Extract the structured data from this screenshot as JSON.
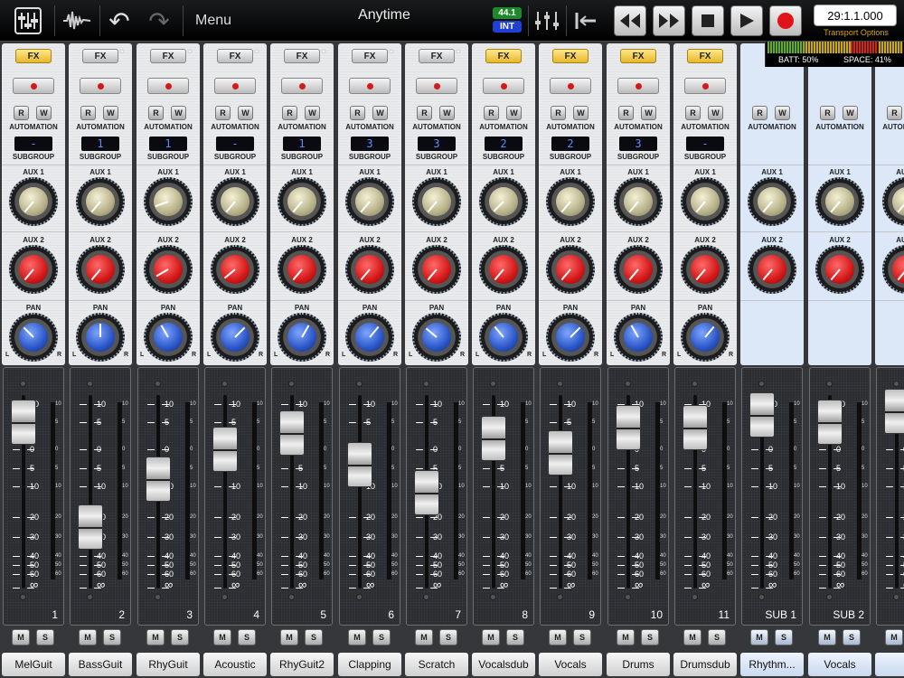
{
  "toolbar": {
    "menu_label": "Menu",
    "song_title": "Anytime",
    "sample_rate": "44.1",
    "clock_source": "INT",
    "counter": "29:1.1.000",
    "transport_options": "Transport Options",
    "battery": "BATT: 50%",
    "space": "SPACE: 41%",
    "icons": [
      "mixer-icon",
      "waveform-icon",
      "undo-icon",
      "redo-icon",
      "edit-tools-icon",
      "return-to-zero-icon",
      "rewind-icon",
      "fast-forward-icon",
      "stop-icon",
      "play-icon",
      "record-icon"
    ]
  },
  "labels": {
    "fx": "FX",
    "automation": "AUTOMATION",
    "subgroup": "SUBGROUP",
    "aux1": "AUX 1",
    "aux2": "AUX 2",
    "pan": "PAN",
    "read": "R",
    "write": "W",
    "mute": "M",
    "solo": "S",
    "pan_left": "L",
    "pan_right": "R"
  },
  "fader_scale": [
    "10",
    "5",
    "0",
    "5",
    "10",
    "20",
    "30",
    "40",
    "50",
    "60",
    "∞"
  ],
  "meter_scale": [
    "10",
    "5",
    "0",
    "5",
    "10",
    "20",
    "30",
    "40",
    "50",
    "60"
  ],
  "channels": [
    {
      "name": "MelGuit",
      "number": "1",
      "fx_active": true,
      "fx_star": false,
      "subgroup": "-",
      "aux1": -140,
      "aux2": -140,
      "pan": -45,
      "fader_db": 5
    },
    {
      "name": "BassGuit",
      "number": "2",
      "fx_active": false,
      "fx_star": true,
      "subgroup": "1",
      "aux1": -140,
      "aux2": -140,
      "pan": 0,
      "fader_db": -25
    },
    {
      "name": "RhyGuit",
      "number": "3",
      "fx_active": false,
      "fx_star": true,
      "subgroup": "1",
      "aux1": -110,
      "aux2": -120,
      "pan": -30,
      "fader_db": -8
    },
    {
      "name": "Acoustic",
      "number": "4",
      "fx_active": false,
      "fx_star": true,
      "subgroup": "-",
      "aux1": -140,
      "aux2": -130,
      "pan": 45,
      "fader_db": 0
    },
    {
      "name": "RhyGuit2",
      "number": "5",
      "fx_active": false,
      "fx_star": true,
      "subgroup": "1",
      "aux1": -140,
      "aux2": -140,
      "pan": 30,
      "fader_db": 3
    },
    {
      "name": "Clapping",
      "number": "6",
      "fx_active": false,
      "fx_star": true,
      "subgroup": "3",
      "aux1": -140,
      "aux2": -140,
      "pan": 40,
      "fader_db": -4
    },
    {
      "name": "Scratch",
      "number": "7",
      "fx_active": false,
      "fx_star": true,
      "subgroup": "3",
      "aux1": -140,
      "aux2": -140,
      "pan": -50,
      "fader_db": -12
    },
    {
      "name": "Vocalsdub",
      "number": "8",
      "fx_active": true,
      "fx_star": false,
      "subgroup": "2",
      "aux1": -135,
      "aux2": -140,
      "pan": -40,
      "fader_db": 2
    },
    {
      "name": "Vocals",
      "number": "9",
      "fx_active": true,
      "fx_star": false,
      "subgroup": "2",
      "aux1": -140,
      "aux2": -140,
      "pan": 45,
      "fader_db": -1
    },
    {
      "name": "Drums",
      "number": "10",
      "fx_active": true,
      "fx_star": false,
      "subgroup": "3",
      "aux1": -140,
      "aux2": -140,
      "pan": -30,
      "fader_db": 4
    },
    {
      "name": "Drumsdub",
      "number": "11",
      "fx_active": true,
      "fx_star": false,
      "subgroup": "-",
      "aux1": -140,
      "aux2": -140,
      "pan": 40,
      "fader_db": 4
    }
  ],
  "subgroups": [
    {
      "name": "Rhythm...",
      "number": "SUB 1",
      "aux1": -140,
      "aux2": -140,
      "fader_db": 7
    },
    {
      "name": "Vocals",
      "number": "SUB 2",
      "aux1": -140,
      "aux2": -140,
      "fader_db": 5
    },
    {
      "name": "",
      "number": "SU",
      "aux1": -140,
      "aux2": -140,
      "fader_db": 8
    }
  ],
  "colors": {
    "fx_active": "#f2cb4a",
    "record": "#d21a1a",
    "aux1": "#b8b28a",
    "aux2": "#d41818",
    "pan": "#2a55c6",
    "subgroup_display": "#5f8cff"
  }
}
